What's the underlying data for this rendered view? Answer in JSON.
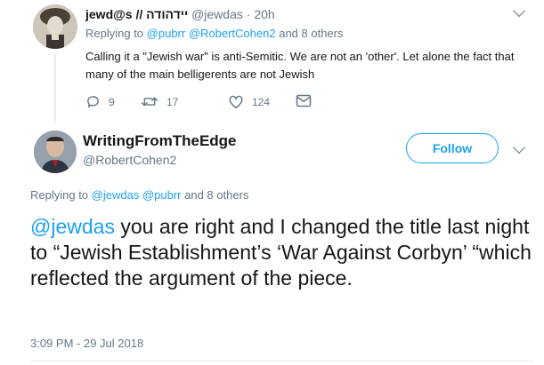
{
  "reply_tweet": {
    "display_name": "jewd@s // יידהודה",
    "handle": "@jewdas",
    "time": "20h",
    "replying_prefix": "Replying to",
    "replying_to": "@pubrr @RobertCohen2",
    "replying_suffix": "and 8 others",
    "text": "Calling it a \"Jewish war\" is anti-Semitic. We are not an 'other'. Let alone the fact that many of the main belligerents are not Jewish",
    "reply_count": "9",
    "retweet_count": "17",
    "like_count": "124"
  },
  "main_tweet": {
    "display_name": "WritingFromTheEdge",
    "handle": "@RobertCohen2",
    "follow_label": "Follow",
    "replying_prefix": "Replying to",
    "replying_to": "@jewdas @pubrr",
    "replying_suffix": "and 8 others",
    "mention": "@jewdas",
    "text": " you are right and I changed the title last night to “Jewish Establishment’s ‘War Against Corbyn’ “which reflected the argument of the piece.",
    "timestamp": "3:09 PM - 29 Jul 2018"
  },
  "icons": {
    "reply": "reply-icon",
    "retweet": "retweet-icon",
    "like": "heart-icon",
    "dm": "envelope-icon",
    "menu": "chevron-down-icon"
  },
  "colors": {
    "accent": "#1da1f2",
    "secondary_text": "#657786",
    "primary_text": "#14171a",
    "divider": "#e6ecf0"
  }
}
